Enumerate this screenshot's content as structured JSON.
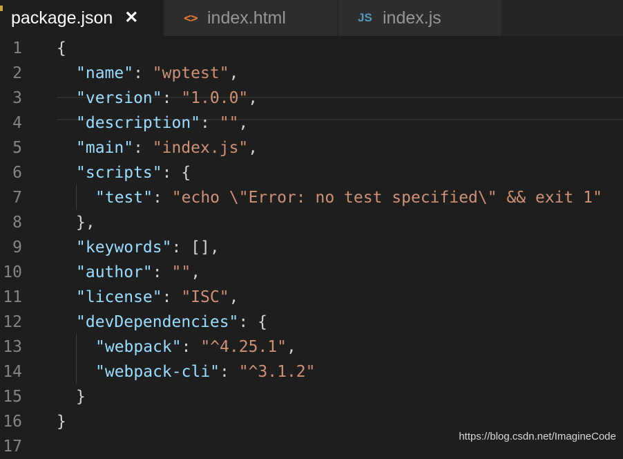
{
  "tabs": [
    {
      "label": "package.json",
      "icon": "json-icon",
      "active": true,
      "close": "✕"
    },
    {
      "label": "index.html",
      "icon": "html-icon",
      "icon_text": "<>"
    },
    {
      "label": "index.js",
      "icon": "js-icon",
      "icon_text": "JS"
    }
  ],
  "editor": {
    "lines": [
      {
        "n": "1",
        "indent": 0,
        "tokens": [
          [
            "p",
            "{"
          ]
        ]
      },
      {
        "n": "2",
        "indent": 1,
        "tokens": [
          [
            "k",
            "\"name\""
          ],
          [
            "p",
            ": "
          ],
          [
            "s",
            "\"wptest\""
          ],
          [
            "p",
            ","
          ]
        ]
      },
      {
        "n": "3",
        "indent": 1,
        "tokens": [
          [
            "k",
            "\"version\""
          ],
          [
            "p",
            ": "
          ],
          [
            "s",
            "\"1.0.0\""
          ],
          [
            "p",
            ","
          ]
        ]
      },
      {
        "n": "4",
        "indent": 1,
        "tokens": [
          [
            "k",
            "\"description\""
          ],
          [
            "p",
            ": "
          ],
          [
            "s",
            "\"\""
          ],
          [
            "p",
            ","
          ]
        ]
      },
      {
        "n": "5",
        "indent": 1,
        "tokens": [
          [
            "k",
            "\"main\""
          ],
          [
            "p",
            ": "
          ],
          [
            "s",
            "\"index.js\""
          ],
          [
            "p",
            ","
          ]
        ]
      },
      {
        "n": "6",
        "indent": 1,
        "tokens": [
          [
            "k",
            "\"scripts\""
          ],
          [
            "p",
            ": {"
          ]
        ]
      },
      {
        "n": "7",
        "indent": 2,
        "tokens": [
          [
            "k",
            "\"test\""
          ],
          [
            "p",
            ": "
          ],
          [
            "s",
            "\"echo \\\"Error: no test specified\\\" && exit 1\""
          ]
        ]
      },
      {
        "n": "8",
        "indent": 1,
        "tokens": [
          [
            "p",
            "},"
          ]
        ]
      },
      {
        "n": "9",
        "indent": 1,
        "tokens": [
          [
            "k",
            "\"keywords\""
          ],
          [
            "p",
            ": [],"
          ]
        ]
      },
      {
        "n": "10",
        "indent": 1,
        "tokens": [
          [
            "k",
            "\"author\""
          ],
          [
            "p",
            ": "
          ],
          [
            "s",
            "\"\""
          ],
          [
            "p",
            ","
          ]
        ]
      },
      {
        "n": "11",
        "indent": 1,
        "tokens": [
          [
            "k",
            "\"license\""
          ],
          [
            "p",
            ": "
          ],
          [
            "s",
            "\"ISC\""
          ],
          [
            "p",
            ","
          ]
        ]
      },
      {
        "n": "12",
        "indent": 1,
        "tokens": [
          [
            "k",
            "\"devDependencies\""
          ],
          [
            "p",
            ": {"
          ]
        ]
      },
      {
        "n": "13",
        "indent": 2,
        "tokens": [
          [
            "k",
            "\"webpack\""
          ],
          [
            "p",
            ": "
          ],
          [
            "s",
            "\"^4.25.1\""
          ],
          [
            "p",
            ","
          ]
        ]
      },
      {
        "n": "14",
        "indent": 2,
        "tokens": [
          [
            "k",
            "\"webpack-cli\""
          ],
          [
            "p",
            ": "
          ],
          [
            "s",
            "\"^3.1.2\""
          ]
        ]
      },
      {
        "n": "15",
        "indent": 1,
        "tokens": [
          [
            "p",
            "}"
          ]
        ]
      },
      {
        "n": "16",
        "indent": 0,
        "tokens": [
          [
            "p",
            "}"
          ]
        ]
      },
      {
        "n": "17",
        "indent": 0,
        "tokens": []
      }
    ]
  },
  "colors": {
    "background": "#1e1e1e",
    "key": "#9cdcfe",
    "string": "#ce9178",
    "punctuation": "#d4d4d4",
    "line_number": "#858585",
    "html_icon": "#e37933",
    "js_icon": "#519aba"
  },
  "watermark": "https://blog.csdn.net/ImagineCode"
}
